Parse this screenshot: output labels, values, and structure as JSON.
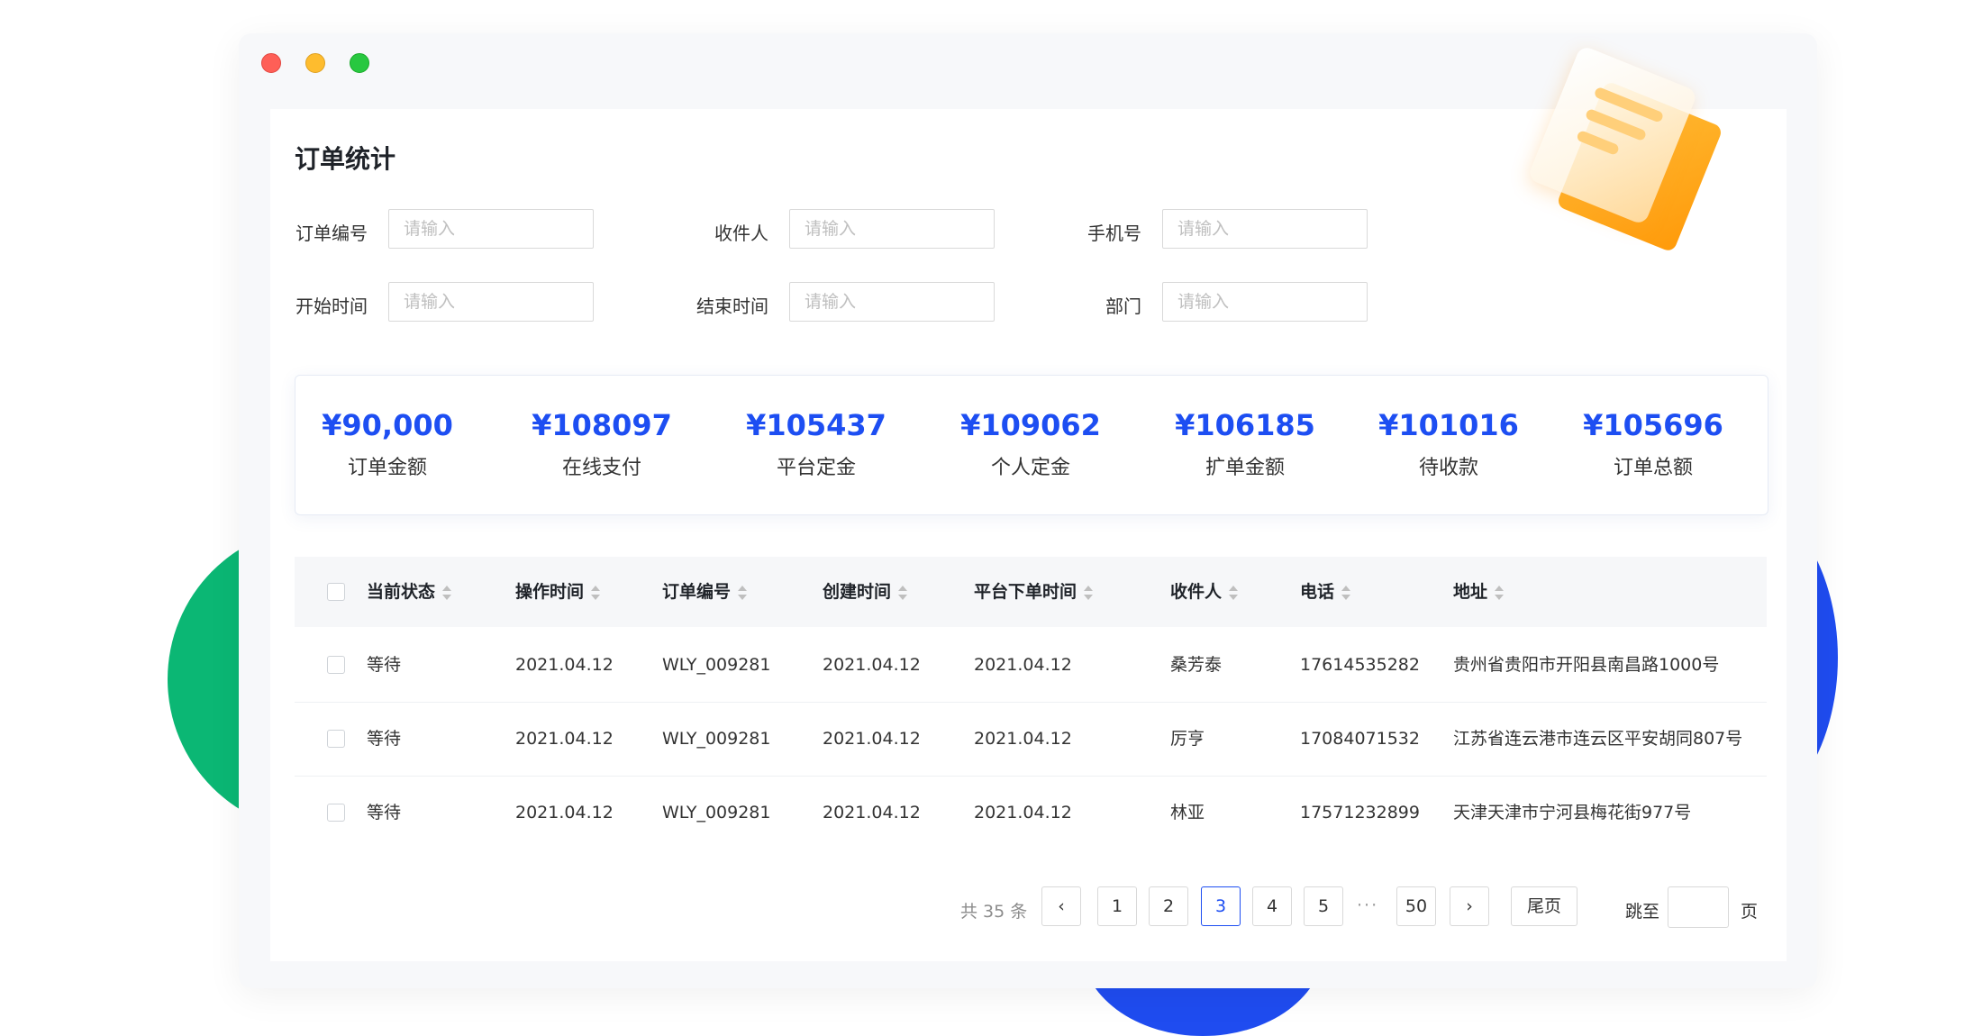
{
  "window": {
    "controls": [
      "close",
      "minimize",
      "zoom"
    ]
  },
  "page": {
    "title": "订单统计"
  },
  "filters": {
    "order_no": {
      "label": "订单编号",
      "placeholder": "请输入"
    },
    "receiver": {
      "label": "收件人",
      "placeholder": "请输入"
    },
    "phone": {
      "label": "手机号",
      "placeholder": "请输入"
    },
    "start_time": {
      "label": "开始时间",
      "placeholder": "请输入"
    },
    "end_time": {
      "label": "结束时间",
      "placeholder": "请输入"
    },
    "department": {
      "label": "部门",
      "placeholder": "请输入"
    }
  },
  "stats": [
    {
      "value": "¥90,000",
      "label": "订单金额"
    },
    {
      "value": "¥108097",
      "label": "在线支付"
    },
    {
      "value": "¥105437",
      "label": "平台定金"
    },
    {
      "value": "¥109062",
      "label": "个人定金"
    },
    {
      "value": "¥106185",
      "label": "扩单金额"
    },
    {
      "value": "¥101016",
      "label": "待收款"
    },
    {
      "value": "¥105696",
      "label": "订单总额"
    }
  ],
  "table": {
    "columns": [
      "当前状态",
      "操作时间",
      "订单编号",
      "创建时间",
      "平台下单时间",
      "收件人",
      "电话",
      "地址"
    ],
    "rows": [
      [
        "等待",
        "2021.04.12",
        "WLY_009281",
        "2021.04.12",
        "2021.04.12",
        "桑芳泰",
        "17614535282",
        "贵州省贵阳市开阳县南昌路1000号"
      ],
      [
        "等待",
        "2021.04.12",
        "WLY_009281",
        "2021.04.12",
        "2021.04.12",
        "厉亨",
        "17084071532",
        "江苏省连云港市连云区平安胡同807号"
      ],
      [
        "等待",
        "2021.04.12",
        "WLY_009281",
        "2021.04.12",
        "2021.04.12",
        "林亚",
        "17571232899",
        "天津天津市宁河县梅花街977号"
      ]
    ]
  },
  "pagination": {
    "total": "共 35 条",
    "prev": "‹",
    "pages": [
      "1",
      "2",
      "3",
      "4",
      "5"
    ],
    "current": "3",
    "ellipsis": "···",
    "last_page": "50",
    "next": "›",
    "last": "尾页",
    "goto": "跳至",
    "page_suffix": "页"
  },
  "colors": {
    "accent": "#1d4ef2",
    "green": "#0bb774",
    "orange": "#ffb020"
  }
}
